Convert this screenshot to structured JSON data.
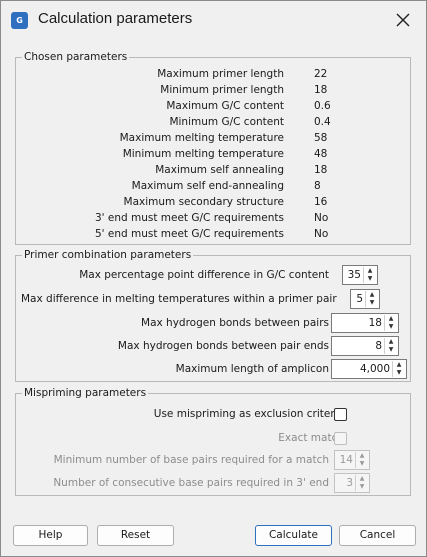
{
  "window": {
    "title": "Calculation parameters",
    "icon_text": "G",
    "icon": "app-icon"
  },
  "chosen": {
    "legend": "Chosen parameters",
    "rows": [
      {
        "label": "Maximum primer length",
        "value": "22"
      },
      {
        "label": "Minimum primer length",
        "value": "18"
      },
      {
        "label": "Maximum G/C content",
        "value": "0.6"
      },
      {
        "label": "Minimum G/C content",
        "value": "0.4"
      },
      {
        "label": "Maximum melting temperature",
        "value": "58"
      },
      {
        "label": "Minimum melting temperature",
        "value": "48"
      },
      {
        "label": "Maximum self annealing",
        "value": "18"
      },
      {
        "label": "Maximum self end-annealing",
        "value": "8"
      },
      {
        "label": "Maximum secondary structure",
        "value": "16"
      },
      {
        "label": "3' end must meet G/C requirements",
        "value": "No"
      },
      {
        "label": "5' end must meet G/C requirements",
        "value": "No"
      }
    ]
  },
  "combination": {
    "legend": "Primer combination parameters",
    "gc_diff": {
      "label": "Max percentage point difference in G/C content",
      "value": "35"
    },
    "tm_diff": {
      "label": "Max difference in melting temperatures within a primer pair",
      "value": "5"
    },
    "hbonds_pairs": {
      "label": "Max hydrogen bonds between pairs",
      "value": "18"
    },
    "hbonds_ends": {
      "label": "Max hydrogen bonds between pair ends",
      "value": "8"
    },
    "amplicon": {
      "label": "Maximum length of amplicon",
      "value": "4,000"
    }
  },
  "mispriming": {
    "legend": "Mispriming parameters",
    "use_exclusion": {
      "label": "Use mispriming as exclusion criteria",
      "checked": false
    },
    "exact_match": {
      "label": "Exact match",
      "checked": false
    },
    "min_base_pairs": {
      "label": "Minimum number of base pairs required for a match",
      "value": "14"
    },
    "consecutive": {
      "label": "Number of consecutive base pairs required in 3' end",
      "value": "3"
    }
  },
  "buttons": {
    "help": "Help",
    "reset": "Reset",
    "calculate": "Calculate",
    "cancel": "Cancel"
  },
  "colors": {
    "accent": "#2f6fbf",
    "background": "#f0f0f0",
    "disabled_text": "#8c8c8c"
  }
}
